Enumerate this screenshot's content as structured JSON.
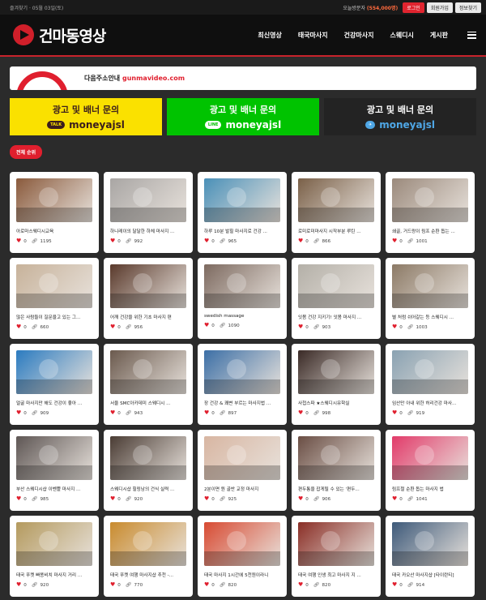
{
  "topbar": {
    "left_text": "즐겨찾기 · 05월 03일(토)",
    "point_label": "오늘방문자",
    "point_value": "(554,000명)",
    "login_label": "로그인",
    "join_label": "회원가입",
    "find_label": "정보찾기"
  },
  "header": {
    "logo_text": "건마동영상",
    "nav": [
      "최신영상",
      "태국마사지",
      "건강마사지",
      "스웨디시",
      "게시판"
    ]
  },
  "notice": {
    "prefix": "다음주소안내",
    "url": "gunmavideo.com"
  },
  "banners": [
    {
      "title": "광고 및 배너 문의",
      "chip": "TALK",
      "id": "moneyajsl"
    },
    {
      "title": "광고 및 배너 문의",
      "chip": "LINE",
      "id": "moneyajsl"
    },
    {
      "title": "광고 및 배너 문의",
      "chip": "✈",
      "id": "moneyajsl"
    }
  ],
  "rank_label": "전체 순위",
  "videos": [
    {
      "title": "아로마스웨디시교육",
      "likes": "0",
      "views": "1195",
      "color": "#8a5a3c"
    },
    {
      "title": "하니레이의 달달한 하체 마사지 ...",
      "likes": "0",
      "views": "992",
      "color": "#a9a6a4"
    },
    {
      "title": "하루 10분 발힐 마사지로 건강 ...",
      "likes": "0",
      "views": "965",
      "color": "#4a90b8"
    },
    {
      "title": "로미로미마사지 시작부분 루틴 ...",
      "likes": "0",
      "views": "866",
      "color": "#7a6048"
    },
    {
      "title": "쇄골, 거드랑이 림프 순환 돕는 ...",
      "likes": "0",
      "views": "1001",
      "color": "#9b8a7c"
    },
    {
      "title": "많은 사람들이 질문을고 있는 그...",
      "likes": "0",
      "views": "660",
      "color": "#c7b29a"
    },
    {
      "title": "어깨 건강을 위한 기초 마사지 편",
      "likes": "0",
      "views": "956",
      "color": "#5a3a2c"
    },
    {
      "title": "swedish massage",
      "likes": "0",
      "views": "1090",
      "color": "#7d6a60"
    },
    {
      "title": "잇몸 건강 지키기! 잇몸 마사지 ...",
      "likes": "0",
      "views": "903",
      "color": "#b4b0a8"
    },
    {
      "title": "별 처럼 쉬어갈는 등 스웨디시 ...",
      "likes": "0",
      "views": "1003",
      "color": "#8c7a66"
    },
    {
      "title": "얼굴 마사지만 해도 건강이 좋아 ...",
      "likes": "0",
      "views": "909",
      "color": "#2b7bc0"
    },
    {
      "title": "서울 SMC아카데미 스웨디시 ...",
      "likes": "0",
      "views": "943",
      "color": "#6b5a4e"
    },
    {
      "title": "장 건강 & 쾌변 부르는 마사지법 ...",
      "likes": "0",
      "views": "897",
      "color": "#3c6fa6"
    },
    {
      "title": "사첩스파 ★스웨디시유학실",
      "likes": "0",
      "views": "998",
      "color": "#3a2a26"
    },
    {
      "title": "임산만 아내 위한 허리건강 마사...",
      "likes": "0",
      "views": "919",
      "color": "#8aa2b2"
    },
    {
      "title": "부산 스웨디시샵 이벤쁠 마사지 ...",
      "likes": "0",
      "views": "985",
      "color": "#5e5654"
    },
    {
      "title": "스웨디시샵 힐링남의 건식 실력 ...",
      "likes": "0",
      "views": "920",
      "color": "#4a3c34"
    },
    {
      "title": "2분이면 뭔 골반 교정 마사지",
      "likes": "0",
      "views": "925",
      "color": "#d8b6a2"
    },
    {
      "title": "편두통을 잡게될 수 있는 '편두...",
      "likes": "0",
      "views": "906",
      "color": "#6a4e44"
    },
    {
      "title": "림프절 순환 돕는 마사지 법",
      "likes": "0",
      "views": "1041",
      "color": "#e23b6a"
    },
    {
      "title": "태국 푸켓 빠똥비치 마사지 거리 ...",
      "likes": "0",
      "views": "920",
      "color": "#b49a5e"
    },
    {
      "title": "태국 푸켓 여행 마사지샵 추천 -...",
      "likes": "0",
      "views": "770",
      "color": "#c98b2e"
    },
    {
      "title": "태국 마사지 1시간에 5천원이라니",
      "likes": "0",
      "views": "820",
      "color": "#d84a32"
    },
    {
      "title": "태국 여행 인생 최고 마사지 지 ...",
      "likes": "0",
      "views": "820",
      "color": "#8a2e26"
    },
    {
      "title": "태국 카오산 마사지샵 [타이란티]",
      "likes": "0",
      "views": "914",
      "color": "#3e5a7a"
    }
  ]
}
